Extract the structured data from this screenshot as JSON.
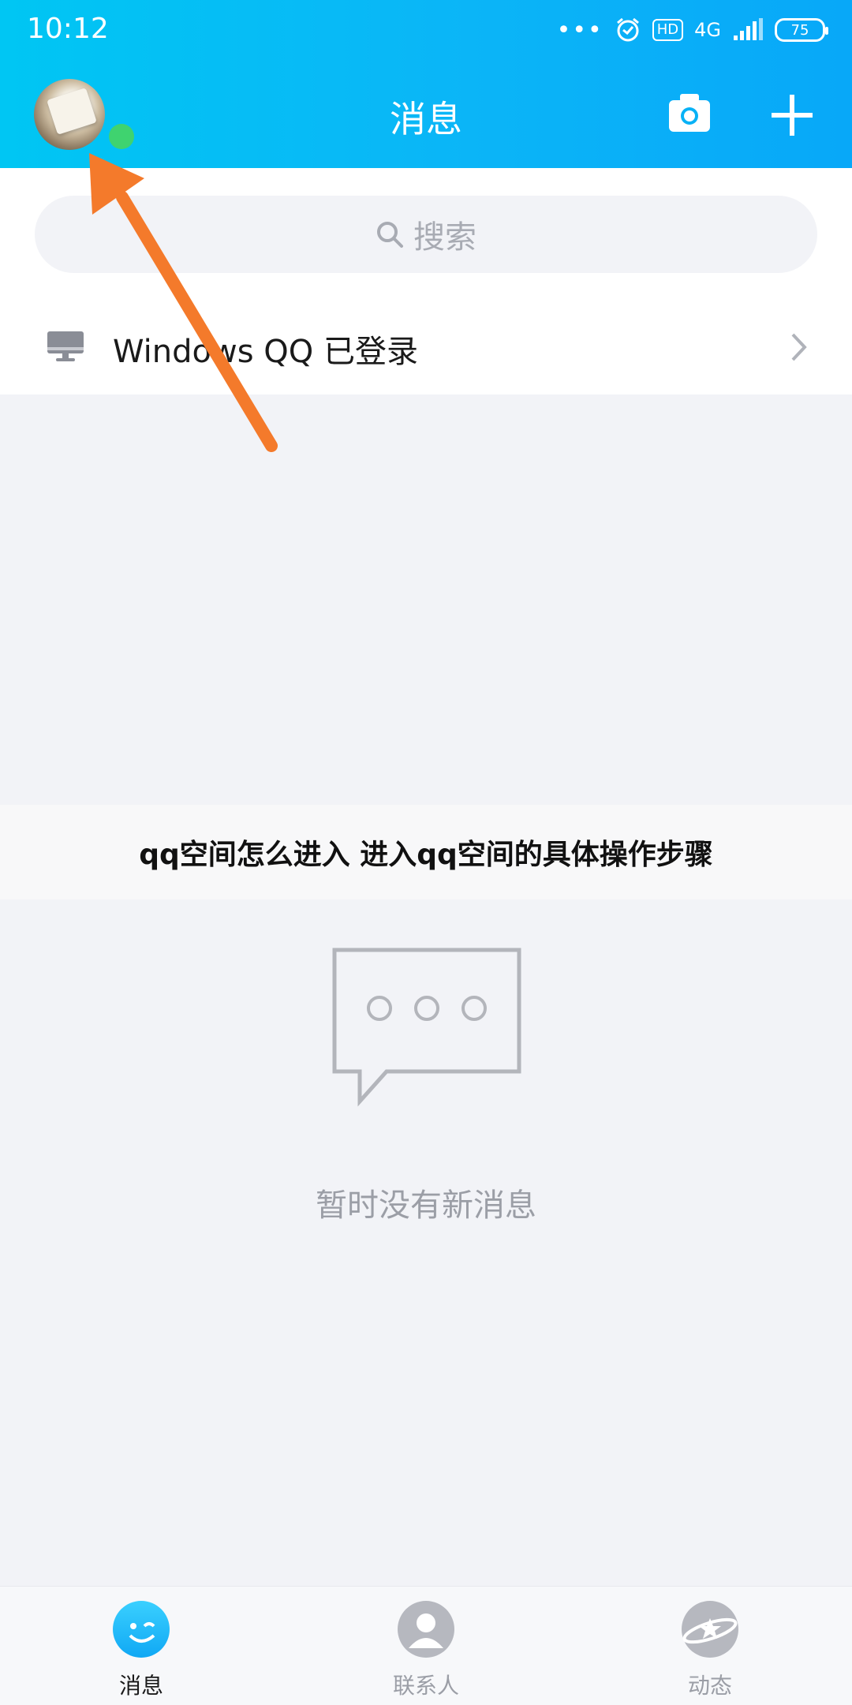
{
  "status_bar": {
    "time": "10:12",
    "dots": "•••",
    "hd": "HD",
    "network": "4G",
    "battery": "75"
  },
  "header": {
    "title": "消息",
    "avatar_icon": "user-avatar",
    "camera_icon": "camera-icon",
    "plus_icon": "plus-icon"
  },
  "search": {
    "placeholder": "搜索",
    "icon": "search-icon"
  },
  "device_row": {
    "label": "Windows QQ 已登录",
    "icon": "desktop-computer-icon"
  },
  "banner": {
    "text": "qq空间怎么进入 进入qq空间的具体操作步骤"
  },
  "empty_state": {
    "icon": "chat-bubble-icon",
    "text": "暂时没有新消息"
  },
  "bottom_nav": {
    "items": [
      {
        "label": "消息",
        "icon": "message-icon",
        "active": true
      },
      {
        "label": "联系人",
        "icon": "contacts-icon",
        "active": false
      },
      {
        "label": "动态",
        "icon": "moments-icon",
        "active": false
      }
    ]
  },
  "colors": {
    "header_start": "#00c6f3",
    "header_end": "#08a8f8",
    "arrow": "#f47a2b",
    "online": "#3fd36f"
  }
}
